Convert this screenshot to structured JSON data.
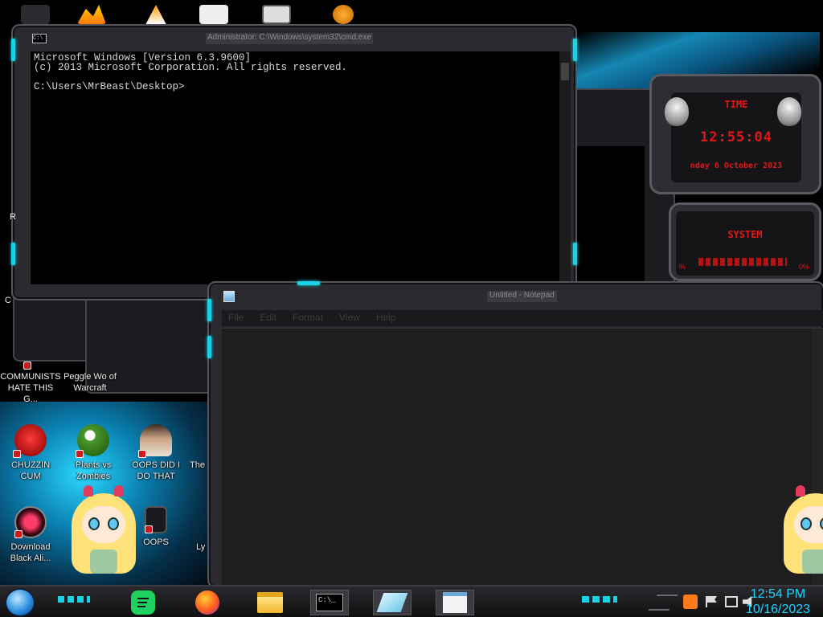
{
  "cmd": {
    "title": "Administrator: C:\\Windows\\system32\\cmd.exe",
    "icon_text": "C:\\",
    "lines": [
      "Microsoft Windows [Version 6.3.9600]",
      "(c) 2013 Microsoft Corporation. All rights reserved.",
      "",
      "C:\\Users\\MrBeast\\Desktop>"
    ]
  },
  "notepad": {
    "title": "Untitled - Notepad",
    "menu": [
      "File",
      "Edit",
      "Format",
      "View",
      "Help"
    ]
  },
  "clock_gadget": {
    "header": "TIME",
    "time": "12:55:04",
    "date": "nday 6 October 2023"
  },
  "sys_gadget": {
    "header": "SYSTEM",
    "left": "%",
    "right": "0%"
  },
  "desktop_icons": [
    {
      "label": "COMMUNISTS HATE THIS G...",
      "icon": "game-icon"
    },
    {
      "label": "Peggle Wo of Warcraft",
      "icon": "peggle-icon"
    },
    {
      "label": "CHUZZIN CUM",
      "icon": "chuzzle-icon"
    },
    {
      "label": "Plants vs Zombies",
      "icon": "plants-vs-zombies-icon"
    },
    {
      "label": "OOPS DID I DO THAT",
      "icon": "portrait-icon"
    },
    {
      "label": "The",
      "icon": "partial-icon"
    },
    {
      "label": "Download Black Ali...",
      "icon": "alienware-icon"
    },
    {
      "label": "OOPS",
      "icon": "monitor-icon"
    },
    {
      "label": "Ly",
      "icon": "partial-icon"
    }
  ],
  "partial_labels": {
    "r": "R",
    "c": "C"
  },
  "taskbar": {
    "time": "12:54 PM",
    "date": "10/16/2023",
    "cmd_glyph": "C:\\_"
  },
  "colors": {
    "accent": "#1ad2e6",
    "clock_red": "#e41616",
    "clock_blue": "#1ed3ff"
  }
}
